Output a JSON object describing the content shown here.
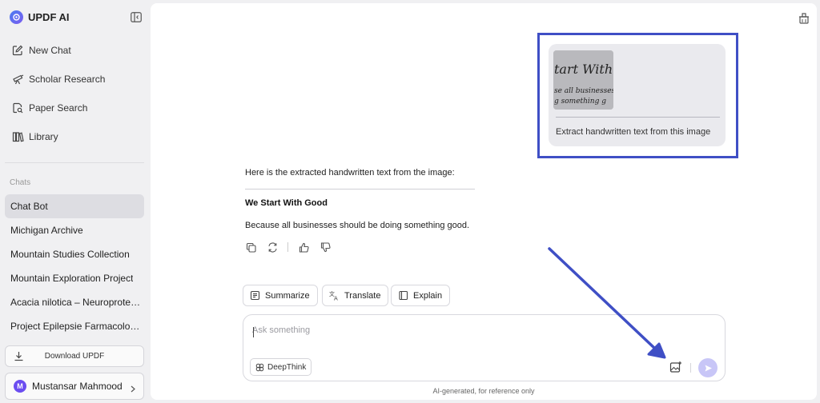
{
  "app": {
    "name": "UPDF AI"
  },
  "nav": [
    {
      "label": "New Chat",
      "icon": "edit-icon"
    },
    {
      "label": "Scholar Research",
      "icon": "telescope-icon"
    },
    {
      "label": "Paper Search",
      "icon": "paper-search-icon"
    },
    {
      "label": "Library",
      "icon": "library-icon"
    }
  ],
  "chats": {
    "section_label": "Chats",
    "items": [
      "Chat Bot",
      "Michigan Archive",
      "Mountain Studies Collection",
      "Mountain Exploration Project",
      "Acacia nilotica – Neuroprotec…",
      "Project Epilepsie Farmacologi…"
    ],
    "active_index": 0
  },
  "download_label": "Download UPDF",
  "user": {
    "initial": "M",
    "name": "Mustansar Mahmood"
  },
  "message": {
    "image_lines": [
      "tart With G",
      "se all businesses",
      "g something g"
    ],
    "text": "Extract handwritten text from this image"
  },
  "response": {
    "intro": "Here is the extracted handwritten text from the image:",
    "heading": "We Start With Good",
    "body": "Because all businesses should be doing something good."
  },
  "quick_actions": [
    "Summarize",
    "Translate",
    "Explain"
  ],
  "input": {
    "placeholder": "Ask something"
  },
  "deepthink_label": "DeepThink",
  "footer_note": "AI-generated, for reference only",
  "colors": {
    "accent": "#3f4fc5",
    "send": "#c8c6f7",
    "avatar": "#6b4df0"
  }
}
